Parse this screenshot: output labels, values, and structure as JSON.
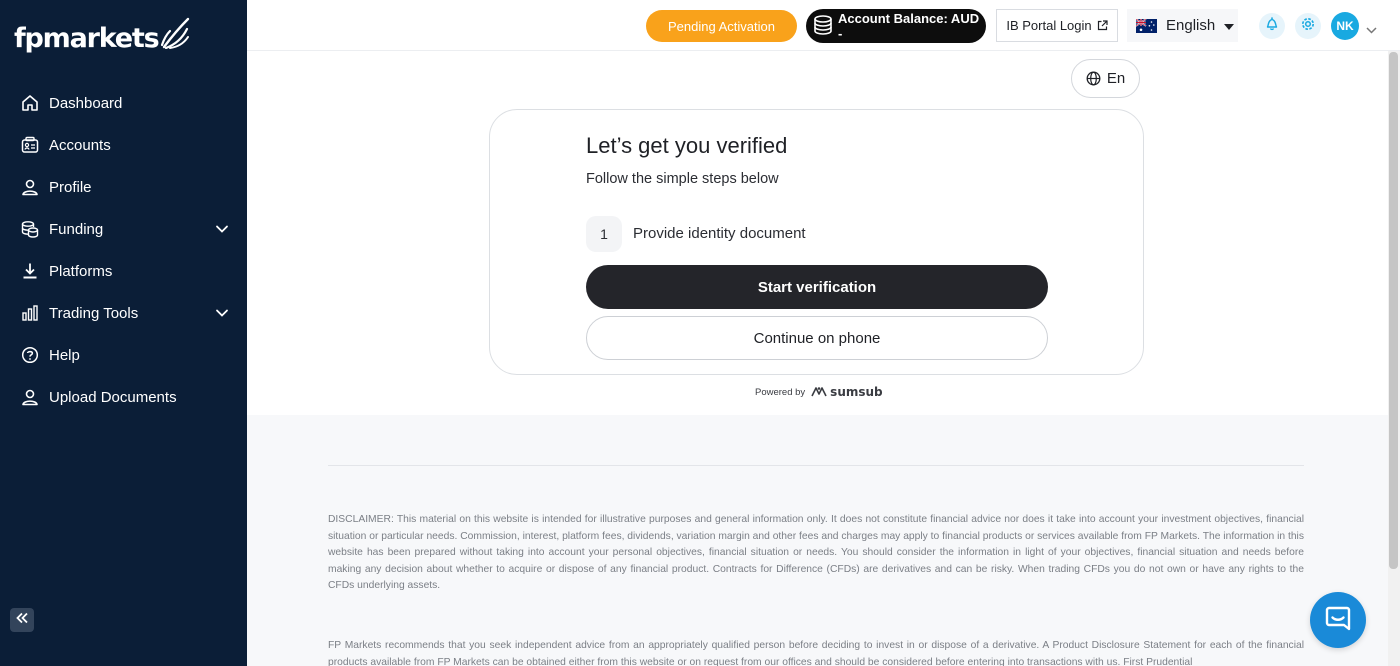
{
  "app": {
    "logo_text": "fpmarkets"
  },
  "sidebar": {
    "items": [
      {
        "label": "Dashboard",
        "icon": "home-icon"
      },
      {
        "label": "Accounts",
        "icon": "accounts-icon"
      },
      {
        "label": "Profile",
        "icon": "user-icon"
      },
      {
        "label": "Funding",
        "icon": "coins-icon",
        "expandable": true
      },
      {
        "label": "Platforms",
        "icon": "download-icon"
      },
      {
        "label": "Trading Tools",
        "icon": "bar-chart-icon",
        "expandable": true
      },
      {
        "label": "Help",
        "icon": "help-icon"
      },
      {
        "label": "Upload Documents",
        "icon": "upload-user-icon"
      }
    ],
    "collapse_icon": "double-chevron-left-icon"
  },
  "topbar": {
    "pending_label": "Pending Activation",
    "balance_label": "Account Balance: AUD -",
    "ib_portal_label": "IB Portal Login",
    "language_label": "English",
    "avatar_initials": "NK"
  },
  "verification": {
    "lang_switch_label": "En",
    "title": "Let’s get you verified",
    "subtitle": "Follow the simple steps below",
    "step_number": "1",
    "step_label": "Provide identity document",
    "start_button": "Start verification",
    "phone_button": "Continue on phone",
    "powered_by": "Powered by",
    "powered_brand": "sumsub"
  },
  "footer": {
    "disclaimer": "DISCLAIMER: This material on this website is intended for illustrative purposes and general information only. It does not constitute financial advice nor does it take into account your investment objectives, financial situation or particular needs. Commission, interest, platform fees, dividends, variation margin and other fees and charges may apply to financial products or services available from FP Markets. The information in this website has been prepared without taking into account your personal objectives, financial situation or needs. You should consider the information in light of your objectives, financial situation and needs before making any decision about whether to acquire or dispose of any financial product. Contracts for Difference (CFDs) are derivatives and can be risky. When trading CFDs you do not own or have any rights to the CFDs underlying assets.",
    "disclaimer2": "FP Markets recommends that you seek independent advice from an appropriately qualified person before deciding to invest in or dispose of a derivative. A Product Disclosure Statement for each of the financial products available from FP Markets can be obtained either from this website or on request from our offices and should be considered before entering into transactions with us. First Prudential"
  },
  "colors": {
    "sidebar_bg": "#0b1e37",
    "pending_orange": "#f9a21b",
    "accent_blue": "#19a9e1",
    "chat_blue": "#1a8ad8"
  }
}
